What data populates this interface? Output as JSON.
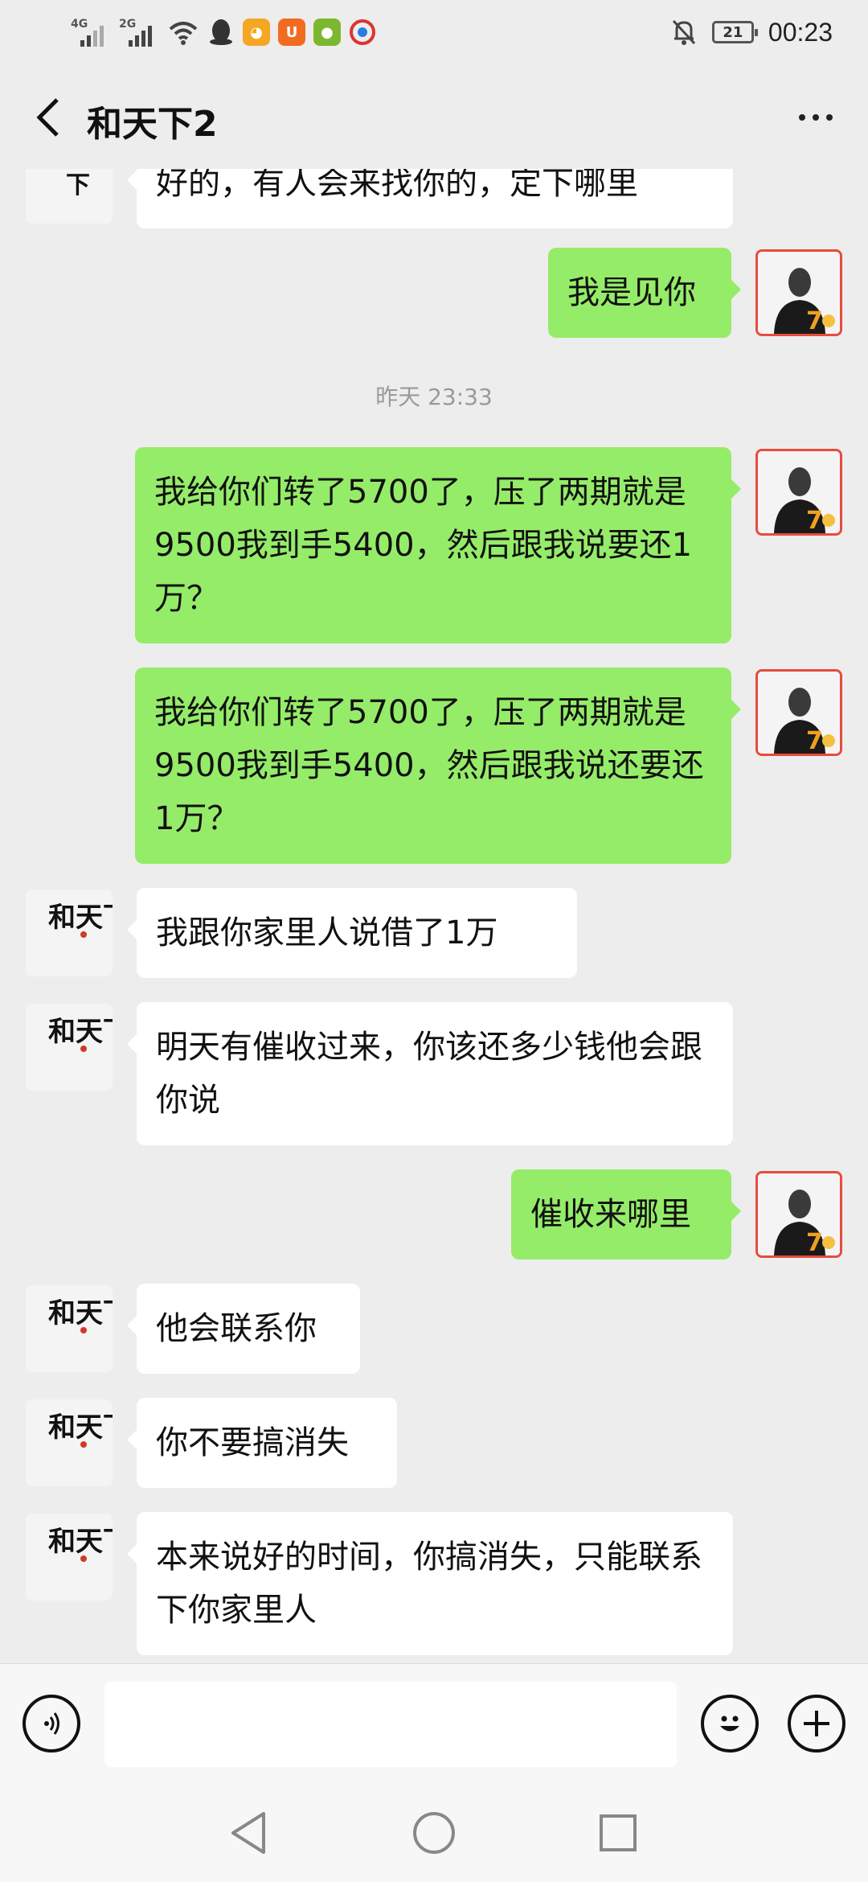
{
  "status_bar": {
    "net1": "4G",
    "net2": "2G",
    "battery": "21",
    "time": "00:23"
  },
  "header": {
    "title": "和天下2"
  },
  "contact_avatar_text": "和天下",
  "messages": [
    {
      "side": "left",
      "text": "好的，有人会来找你的，定下哪里"
    },
    {
      "side": "right",
      "text": "我是见你"
    },
    {
      "type": "timestamp",
      "text": "昨天 23:33"
    },
    {
      "side": "right",
      "text": "我给你们转了5700了，压了两期就是9500我到手5400，然后跟我说要还1万？"
    },
    {
      "side": "right",
      "text": "我给你们转了5700了，压了两期就是9500我到手5400，然后跟我说还要还1万？"
    },
    {
      "side": "left",
      "text": "我跟你家里人说借了1万"
    },
    {
      "side": "left",
      "text": "明天有催收过来，你该还多少钱他会跟你说"
    },
    {
      "side": "right",
      "text": "催收来哪里"
    },
    {
      "side": "left",
      "text": "他会联系你"
    },
    {
      "side": "left",
      "text": "你不要搞消失"
    },
    {
      "side": "left",
      "text": "本来说好的时间，你搞消失，只能联系下你家里人"
    }
  ],
  "input": {
    "placeholder": ""
  },
  "colors": {
    "outgoing_bubble": "#95ec69",
    "incoming_bubble": "#ffffff",
    "background": "#ededed"
  }
}
